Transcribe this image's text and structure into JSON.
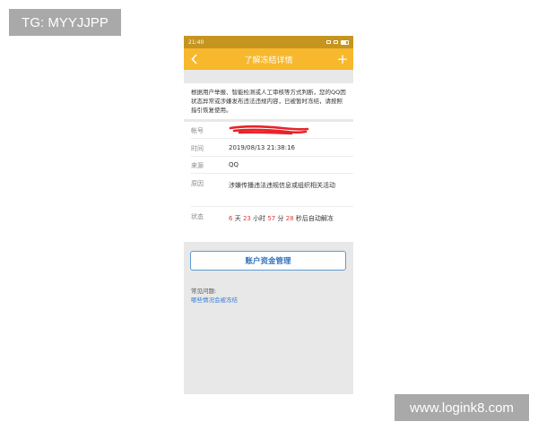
{
  "watermarks": {
    "top_left": "TG: MYYJJPP",
    "bottom_right": "www.logink8.com"
  },
  "statusbar": {
    "time": "21:40"
  },
  "navbar": {
    "title": "了解冻结详情",
    "add_label": "+",
    "back_icon": "chevron-left-icon"
  },
  "notice": {
    "text": "根据用户举报、智能检测或人工审核等方式判断，您的QQ因状态异常或涉嫌发布违法违规内容，已被暂时冻结，请按照指引恢复使用。"
  },
  "details": {
    "account_label": "帐号",
    "time_label": "时间",
    "time_value": "2019/08/13  21:38:16",
    "source_label": "来源",
    "source_value": "QQ",
    "reason_label": "原因",
    "reason_value": "涉嫌传播违法违规信息或组织相关活动",
    "status_label": "状态",
    "status": {
      "days": "6",
      "days_unit": "天",
      "hours": "23",
      "hours_unit": "小时",
      "minutes": "57",
      "minutes_unit": "分",
      "seconds": "28",
      "seconds_unit": "秒后自动解冻"
    }
  },
  "actions": {
    "account_funds_button": "账户资金管理"
  },
  "faq": {
    "title": "常见问题:",
    "link": "哪些情况会被冻结"
  },
  "colors": {
    "navbar": "#f7b82d",
    "statusbar": "#c69520",
    "countdown": "#e23a3a",
    "button_text": "#2f72b9",
    "link": "#3c7fd1"
  }
}
